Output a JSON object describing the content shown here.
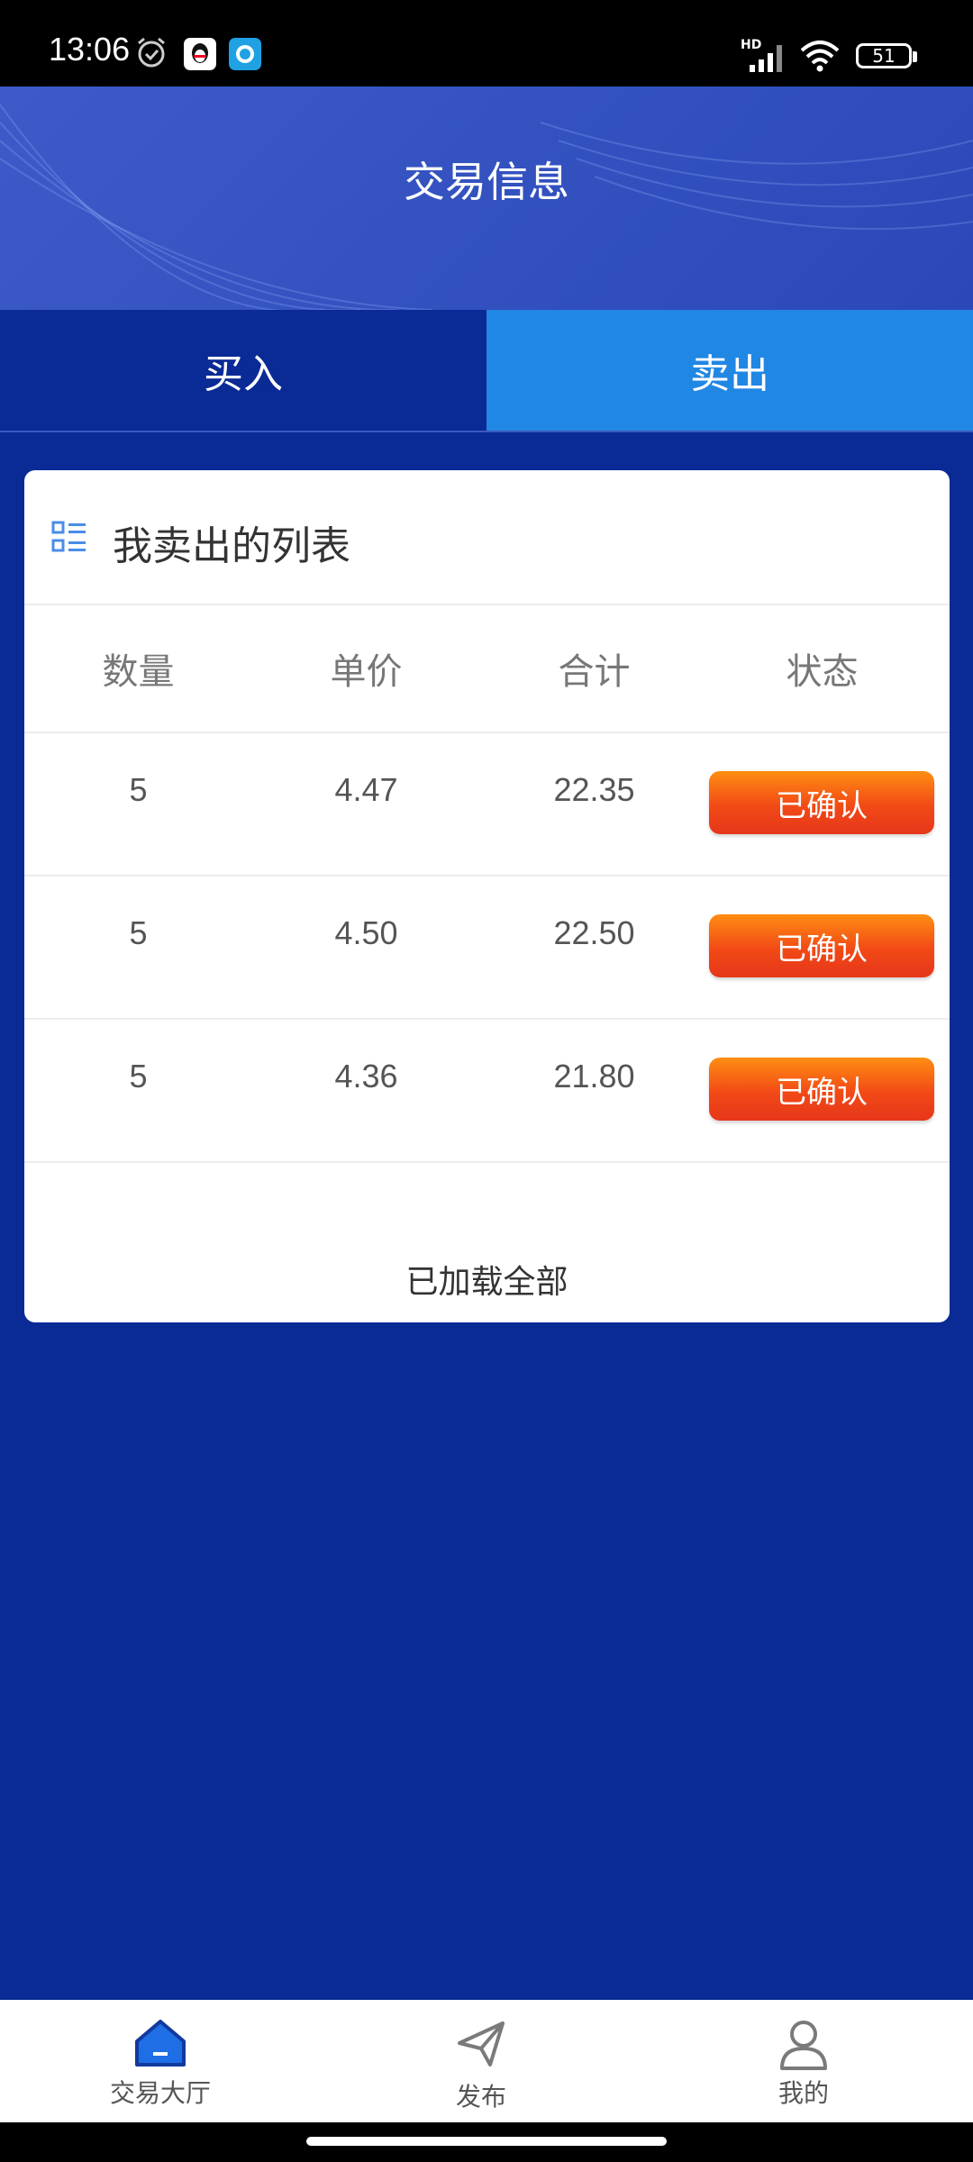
{
  "status_bar": {
    "time": "13:06",
    "network": "HD",
    "battery": "51",
    "icons": [
      "alarm-icon",
      "qq-icon",
      "app-icon",
      "signal-icon",
      "wifi-icon",
      "battery-icon"
    ]
  },
  "header": {
    "title": "交易信息"
  },
  "tabs": [
    {
      "label": "买入",
      "active": false
    },
    {
      "label": "卖出",
      "active": true
    }
  ],
  "card": {
    "title": "我卖出的列表",
    "columns": [
      "数量",
      "单价",
      "合计",
      "状态"
    ],
    "rows": [
      {
        "quantity": "5",
        "price": "4.47",
        "total": "22.35",
        "status": "已确认"
      },
      {
        "quantity": "5",
        "price": "4.50",
        "total": "22.50",
        "status": "已确认"
      },
      {
        "quantity": "5",
        "price": "4.36",
        "total": "21.80",
        "status": "已确认"
      }
    ],
    "footer": "已加载全部"
  },
  "bottom_nav": [
    {
      "label": "交易大厅",
      "icon": "home-icon",
      "active": true
    },
    {
      "label": "发布",
      "icon": "paper-plane-icon",
      "active": false
    },
    {
      "label": "我的",
      "icon": "user-icon",
      "active": false
    }
  ],
  "colors": {
    "background": "#0a2a96",
    "header": "#3352c0",
    "active_tab": "#2187e4",
    "status_button": "#f24a16"
  }
}
